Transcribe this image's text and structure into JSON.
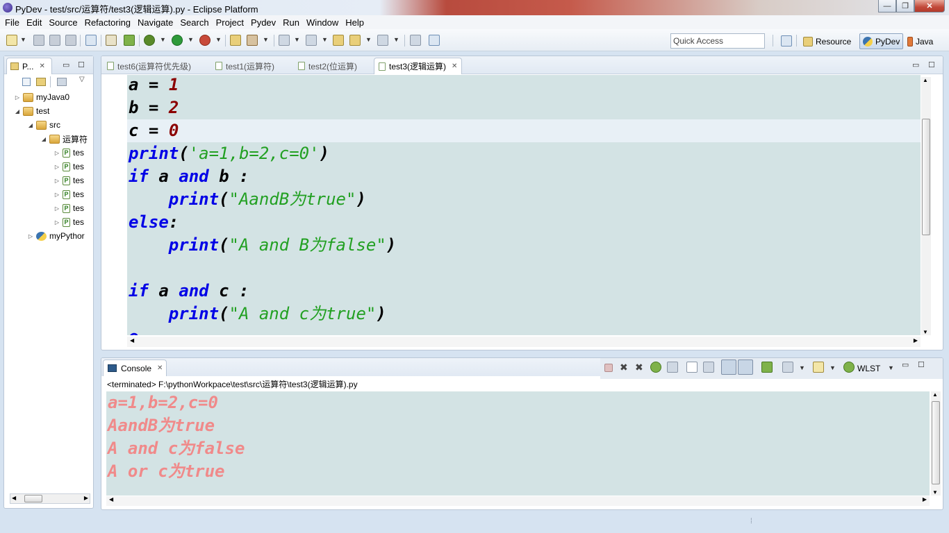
{
  "window": {
    "title": "PyDev - test/src/运算符/test3(逻辑运算).py - Eclipse Platform",
    "min_label": "—",
    "max_label": "❐",
    "close_label": "✕"
  },
  "menus": [
    "File",
    "Edit",
    "Source",
    "Refactoring",
    "Navigate",
    "Search",
    "Project",
    "Pydev",
    "Run",
    "Window",
    "Help"
  ],
  "toolbar": {
    "quick_access_placeholder": "Quick Access",
    "perspectives": [
      {
        "label": "Resource",
        "active": false
      },
      {
        "label": "PyDev",
        "active": true
      },
      {
        "label": "Java",
        "active": false
      }
    ]
  },
  "explorer": {
    "tab_label": "P...",
    "tree": [
      {
        "label": "myJava0",
        "indent": 0,
        "expanded": false,
        "icon": "project-icon"
      },
      {
        "label": "test",
        "indent": 0,
        "expanded": true,
        "icon": "project-icon"
      },
      {
        "label": "src",
        "indent": 1,
        "expanded": true,
        "icon": "source-folder-icon"
      },
      {
        "label": "运算符",
        "indent": 2,
        "expanded": true,
        "icon": "package-folder-icon"
      },
      {
        "label": "tes",
        "indent": 3,
        "expanded": false,
        "icon": "python-file-icon"
      },
      {
        "label": "tes",
        "indent": 3,
        "expanded": false,
        "icon": "python-file-icon"
      },
      {
        "label": "tes",
        "indent": 3,
        "expanded": false,
        "icon": "python-file-icon"
      },
      {
        "label": "tes",
        "indent": 3,
        "expanded": false,
        "icon": "python-file-icon"
      },
      {
        "label": "tes",
        "indent": 3,
        "expanded": false,
        "icon": "python-file-icon"
      },
      {
        "label": "tes",
        "indent": 3,
        "expanded": false,
        "icon": "python-file-icon"
      },
      {
        "label": "myPythor",
        "indent": 1,
        "expanded": false,
        "icon": "python-project-icon"
      }
    ]
  },
  "editor": {
    "tabs": [
      {
        "label": "test6(运算符优先级)",
        "active": false
      },
      {
        "label": "test1(运算符)",
        "active": false
      },
      {
        "label": "test2(位运算)",
        "active": false
      },
      {
        "label": "test3(逻辑运算)",
        "active": true
      }
    ],
    "code_lines": [
      {
        "indent": "",
        "current": false,
        "tokens": [
          {
            "t": "a",
            "c": "id"
          },
          {
            "t": " = ",
            "c": "id"
          },
          {
            "t": "1",
            "c": "num"
          }
        ]
      },
      {
        "indent": "",
        "current": false,
        "tokens": [
          {
            "t": "b",
            "c": "id"
          },
          {
            "t": " = ",
            "c": "id"
          },
          {
            "t": "2",
            "c": "num"
          }
        ]
      },
      {
        "indent": "",
        "current": true,
        "tokens": [
          {
            "t": "c",
            "c": "id"
          },
          {
            "t": " = ",
            "c": "id"
          },
          {
            "t": "0",
            "c": "num"
          }
        ]
      },
      {
        "indent": "",
        "current": false,
        "tokens": [
          {
            "t": "print",
            "c": "kw"
          },
          {
            "t": "(",
            "c": "id"
          },
          {
            "t": "'a=1,b=2,c=0'",
            "c": "str"
          },
          {
            "t": ")",
            "c": "id"
          }
        ]
      },
      {
        "indent": "",
        "current": false,
        "tokens": [
          {
            "t": "if",
            "c": "kw"
          },
          {
            "t": " a ",
            "c": "id"
          },
          {
            "t": "and",
            "c": "kw"
          },
          {
            "t": " b :",
            "c": "id"
          }
        ]
      },
      {
        "indent": "    ",
        "current": false,
        "tokens": [
          {
            "t": "print",
            "c": "kw"
          },
          {
            "t": "(",
            "c": "id"
          },
          {
            "t": "\"AandB为true\"",
            "c": "str"
          },
          {
            "t": ")",
            "c": "id"
          }
        ]
      },
      {
        "indent": "",
        "current": false,
        "tokens": [
          {
            "t": "else",
            "c": "kw"
          },
          {
            "t": ":",
            "c": "id"
          }
        ]
      },
      {
        "indent": "    ",
        "current": false,
        "tokens": [
          {
            "t": "print",
            "c": "kw"
          },
          {
            "t": "(",
            "c": "id"
          },
          {
            "t": "\"A and B为false\"",
            "c": "str"
          },
          {
            "t": ")",
            "c": "id"
          }
        ]
      },
      {
        "indent": "",
        "current": false,
        "tokens": []
      },
      {
        "indent": "",
        "current": false,
        "tokens": [
          {
            "t": "if",
            "c": "kw"
          },
          {
            "t": " a ",
            "c": "id"
          },
          {
            "t": "and",
            "c": "kw"
          },
          {
            "t": " c :",
            "c": "id"
          }
        ]
      },
      {
        "indent": "    ",
        "current": false,
        "tokens": [
          {
            "t": "print",
            "c": "kw"
          },
          {
            "t": "(",
            "c": "id"
          },
          {
            "t": "\"A and c为true\"",
            "c": "str"
          },
          {
            "t": ")",
            "c": "id"
          }
        ]
      },
      {
        "indent": "",
        "current": false,
        "tokens": [
          {
            "t": "e",
            "c": "kw"
          }
        ]
      }
    ]
  },
  "console": {
    "tab_label": "Console",
    "wlst_label": "WLST",
    "terminated_label": "<terminated>",
    "terminated_path": " F:\\pythonWorkpace\\test\\src\\运算符\\test3(逻辑运算).py",
    "output": [
      "a=1,b=2,c=0",
      "AandB为true",
      "A and c为false",
      "A or c为true"
    ]
  },
  "colors": {
    "keyword": "#0000e6",
    "number": "#8b0000",
    "string": "#22a022",
    "console_output": "#f08a8a",
    "editor_bg": "#d3e3e4"
  }
}
